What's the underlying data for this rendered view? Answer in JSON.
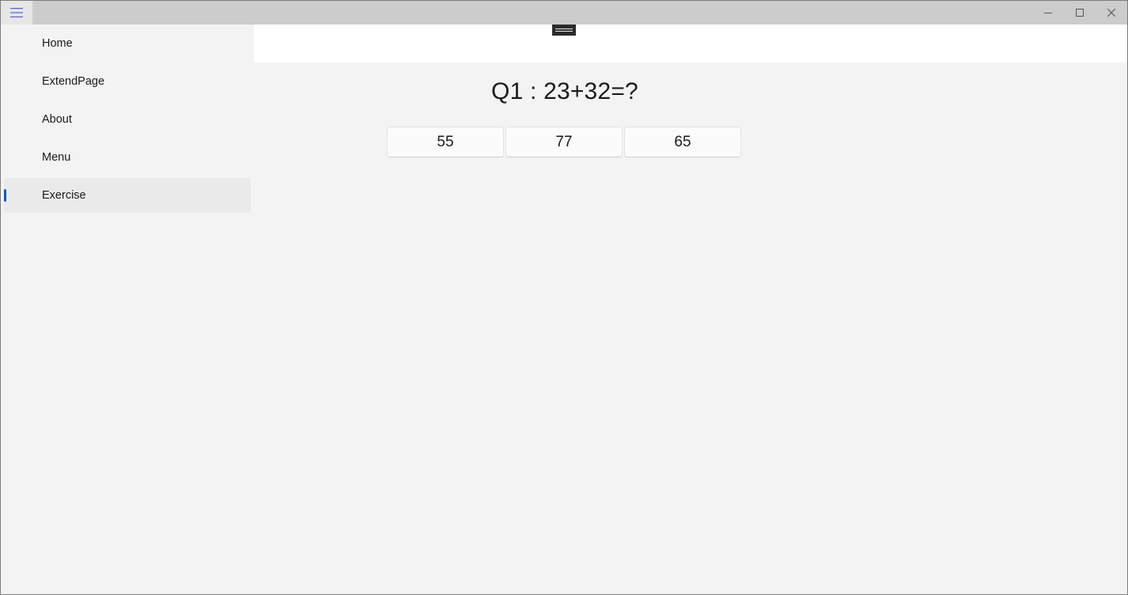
{
  "nav": {
    "items": [
      {
        "label": "Home"
      },
      {
        "label": "ExtendPage"
      },
      {
        "label": "About"
      },
      {
        "label": "Menu"
      },
      {
        "label": "Exercise",
        "selected": true
      }
    ]
  },
  "main": {
    "question": "Q1 : 23+32=?",
    "answers": [
      "55",
      "77",
      "65"
    ]
  },
  "colors": {
    "accent": "#005fb8",
    "titlebar": "#cccccc",
    "hamburger_icon": "#5b5fc7"
  },
  "icons": {
    "hamburger": "hamburger-menu-icon",
    "minimize": "minimize-icon",
    "maximize": "maximize-icon",
    "close": "close-icon"
  }
}
